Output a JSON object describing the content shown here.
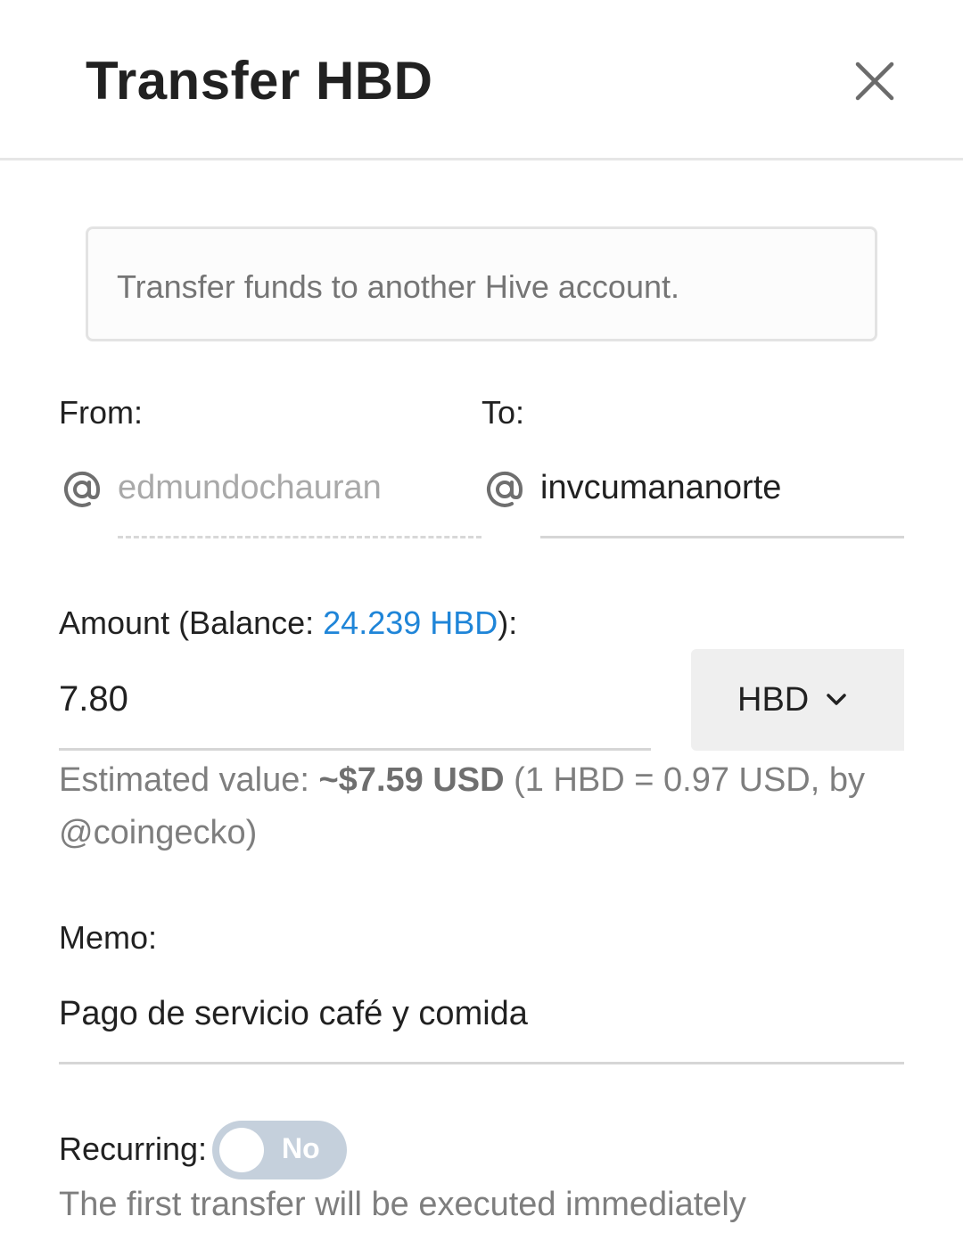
{
  "header": {
    "title": "Transfer HBD",
    "close_icon": "close-icon"
  },
  "info": {
    "text": "Transfer funds to another Hive account."
  },
  "from": {
    "label": "From:",
    "icon": "at-icon",
    "value": "edmundochauran"
  },
  "to": {
    "label": "To:",
    "icon": "at-icon",
    "value": "invcumananorte"
  },
  "amount": {
    "label_prefix": "Amount (Balance: ",
    "balance": "24.239 HBD",
    "label_suffix": "):",
    "value": "7.80",
    "currency": "HBD",
    "currency_icon": "chevron-down-icon"
  },
  "estimate": {
    "prefix": "Estimated value: ",
    "value": "~$7.59 USD",
    "suffix": " (1 HBD = 0.97 USD, by @coingecko)"
  },
  "memo": {
    "label": "Memo:",
    "value": "Pago de servicio café y comida"
  },
  "recurring": {
    "label": "Recurring:",
    "toggle_text": "No",
    "note": "The first transfer will be executed immediately"
  },
  "colors": {
    "accent": "#1f85d8",
    "toggle_off": "#c5d0dc"
  }
}
